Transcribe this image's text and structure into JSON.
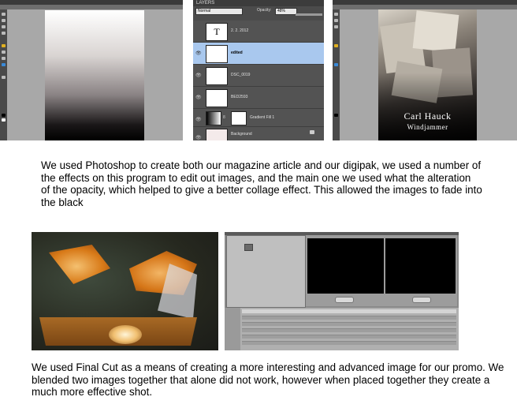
{
  "photoshop_layers": {
    "panel_title": "LAYERS",
    "blend_mode": "Normal",
    "opacity_label": "Opacity:",
    "opacity_value": "48%",
    "layers": [
      {
        "name": "2. 2. 2012",
        "selected": false
      },
      {
        "name": "edited",
        "selected": true
      },
      {
        "name": "DSC_0019",
        "selected": false
      },
      {
        "name": "BED2593",
        "selected": false
      },
      {
        "name": "Gradient Fill 1",
        "selected": false
      },
      {
        "name": "Background",
        "selected": false
      }
    ]
  },
  "digipak_cover": {
    "artist": "Carl Hauck",
    "album": "Windjammer"
  },
  "paragraphs": {
    "photoshop": "We used Photoshop to create both our magazine article and our digipak, we used a number of the effects on this program to edit out images, and the main one we used what the alteration of the opacity, which helped to give a better collage effect. This allowed the images to fade into the black",
    "final_cut": "We used Final Cut as a means of creating a more interesting and advanced image for our promo. We blended two images together that alone did not work, however when placed together they create a much more effective shot."
  }
}
